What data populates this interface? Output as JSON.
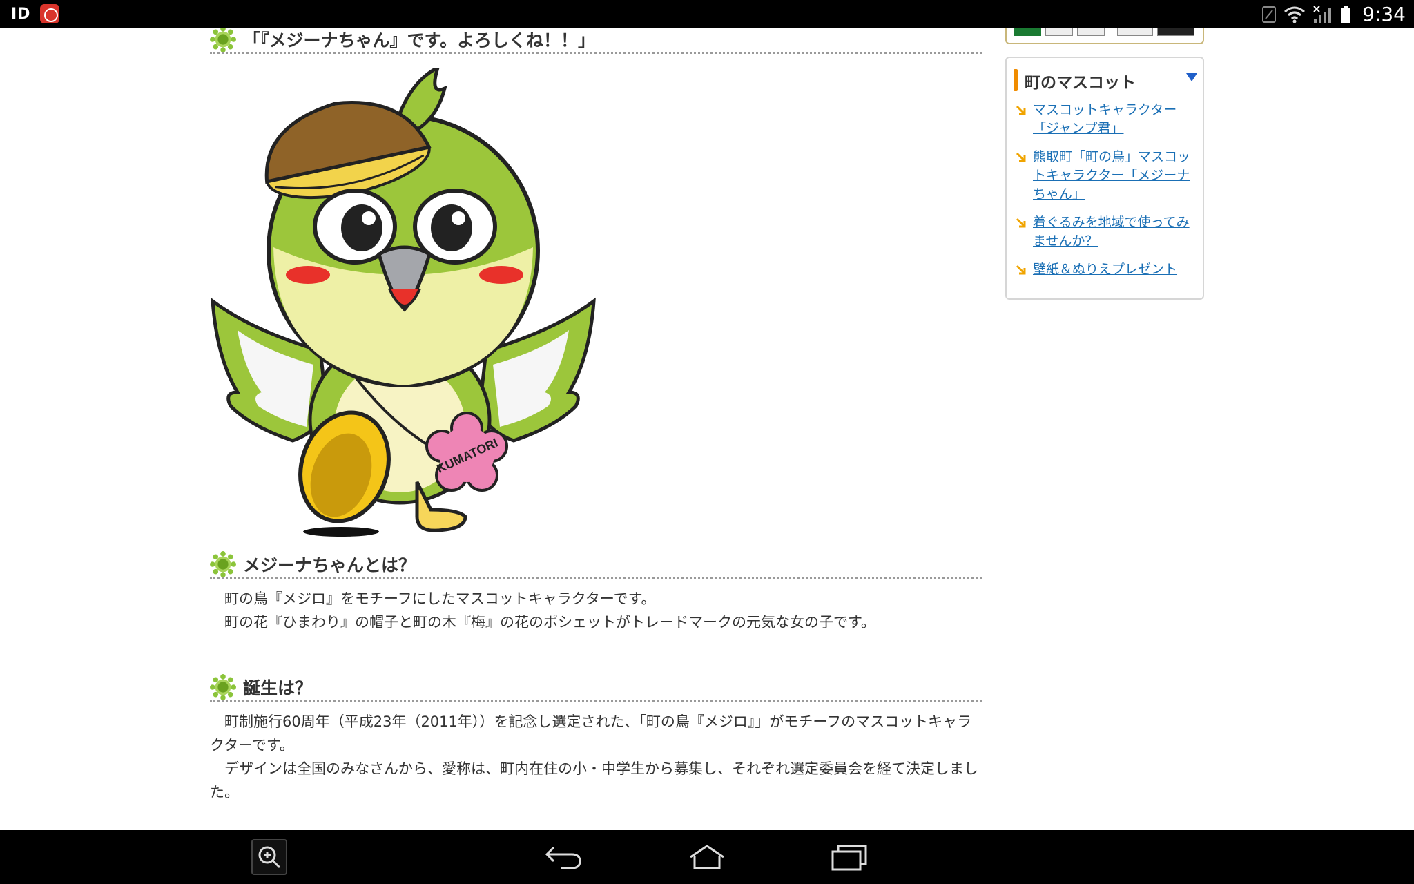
{
  "statusbar": {
    "left_label": "ID",
    "time": "9:34",
    "icons": [
      "app-notification-icon",
      "sim-icon",
      "wifi-icon",
      "signal-icon",
      "battery-icon"
    ]
  },
  "sections": [
    {
      "heading": "「『メジーナちゃん』です。よろしくね！！」"
    },
    {
      "heading": "メジーナちゃんとは？",
      "paragraphs": [
        "　町の鳥『メジロ』をモチーフにしたマスコットキャラクターです。",
        "　町の花『ひまわり』の帽子と町の木『梅』の花のポシェットがトレードマークの元気な女の子です。"
      ]
    },
    {
      "heading": "誕生は？",
      "paragraphs": [
        "　町制施行60周年（平成23年（2011年））を記念し選定された、「町の鳥『メジロ』」がモチーフのマスコットキャラクターです。",
        "　デザインは全国のみなさんから、愛称は、町内在住の小・中学生から募集し、それぞれ選定委員会を経て決定しました。"
      ]
    }
  ],
  "mascot": {
    "badge_text": "KUMATORI"
  },
  "sidebar": {
    "title": "町のマスコット",
    "links": [
      "マスコットキャラクター「ジャンプ君」",
      "熊取町「町の鳥」マスコットキャラクター「メジーナちゃん」",
      "着ぐるみを地域で使ってみませんか？",
      "壁紙＆ぬりえプレゼント"
    ]
  },
  "colors": {
    "accent_orange": "#f08c00",
    "link_blue": "#1a6fb5",
    "sun_green": "#7db82b"
  },
  "navbar": {
    "buttons": [
      "zoom-icon",
      "back-icon",
      "home-icon",
      "recents-icon"
    ]
  }
}
